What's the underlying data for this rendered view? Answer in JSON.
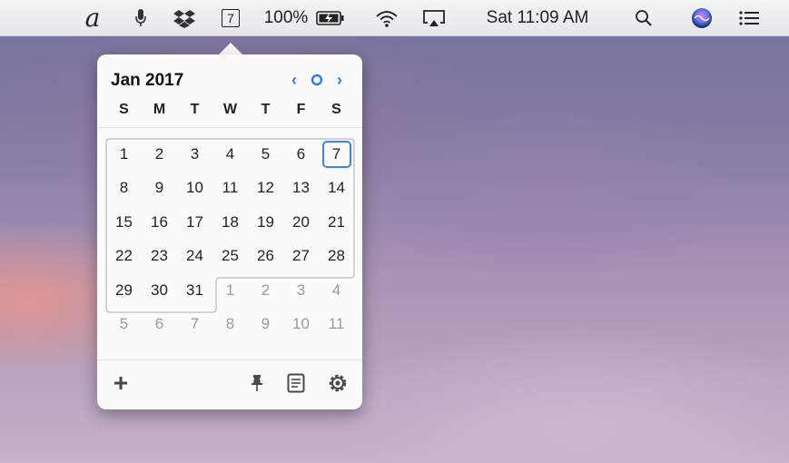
{
  "menubar": {
    "items": [
      {
        "name": "script-a-icon",
        "glyph": "𝒶"
      },
      {
        "name": "microphone-icon",
        "glyph": "🎙"
      },
      {
        "name": "dropbox-icon",
        "glyph": "✥"
      }
    ],
    "calendar_badge": "7",
    "battery_percent": "100%",
    "clock": "Sat 11:09 AM"
  },
  "calendar": {
    "month_title": "Jan 2017",
    "nav": {
      "prev": "‹",
      "today": "○",
      "next": "›"
    },
    "weekday_headers": [
      "S",
      "M",
      "T",
      "W",
      "T",
      "F",
      "S"
    ],
    "weeks": [
      [
        {
          "d": "1"
        },
        {
          "d": "2"
        },
        {
          "d": "3"
        },
        {
          "d": "4"
        },
        {
          "d": "5"
        },
        {
          "d": "6"
        },
        {
          "d": "7",
          "today": true
        }
      ],
      [
        {
          "d": "8"
        },
        {
          "d": "9"
        },
        {
          "d": "10"
        },
        {
          "d": "11"
        },
        {
          "d": "12"
        },
        {
          "d": "13"
        },
        {
          "d": "14"
        }
      ],
      [
        {
          "d": "15"
        },
        {
          "d": "16"
        },
        {
          "d": "17"
        },
        {
          "d": "18"
        },
        {
          "d": "19"
        },
        {
          "d": "20"
        },
        {
          "d": "21"
        }
      ],
      [
        {
          "d": "22"
        },
        {
          "d": "23"
        },
        {
          "d": "24"
        },
        {
          "d": "25"
        },
        {
          "d": "26"
        },
        {
          "d": "27"
        },
        {
          "d": "28"
        }
      ],
      [
        {
          "d": "29"
        },
        {
          "d": "30"
        },
        {
          "d": "31"
        },
        {
          "d": "1",
          "other": true
        },
        {
          "d": "2",
          "other": true
        },
        {
          "d": "3",
          "other": true
        },
        {
          "d": "4",
          "other": true
        }
      ],
      [
        {
          "d": "5",
          "other": true
        },
        {
          "d": "6",
          "other": true
        },
        {
          "d": "7",
          "other": true
        },
        {
          "d": "8",
          "other": true
        },
        {
          "d": "9",
          "other": true
        },
        {
          "d": "10",
          "other": true
        },
        {
          "d": "11",
          "other": true
        }
      ]
    ],
    "toolbar": {
      "add": "+"
    }
  },
  "colors": {
    "accent": "#2d7cf6",
    "today_border": "#3b82f6"
  }
}
